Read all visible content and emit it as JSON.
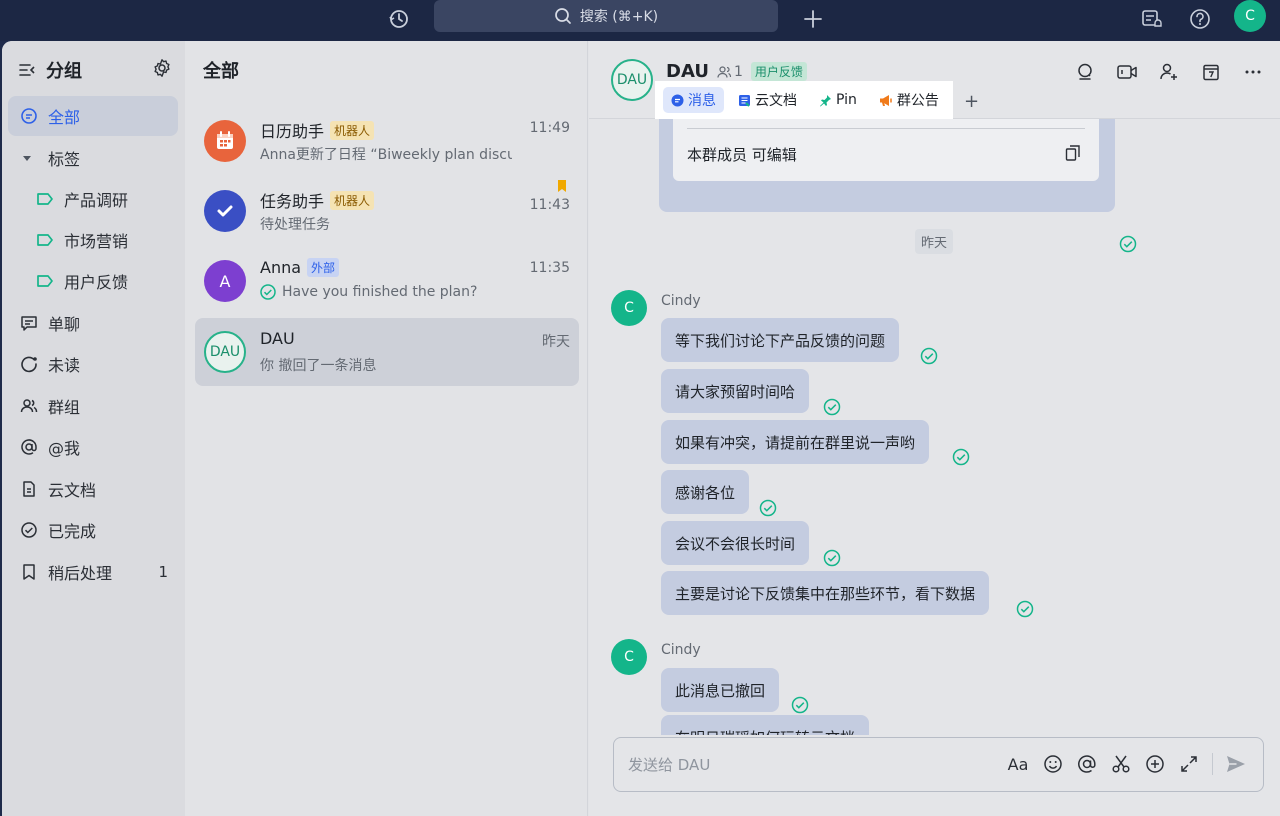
{
  "topbar": {
    "search_placeholder": "搜索 (⌘+K)",
    "avatar_initial": "C"
  },
  "sidebar": {
    "title": "分组",
    "items": [
      {
        "label": "全部",
        "icon": "chat-bubble-icon",
        "active": true
      },
      {
        "label": "标签",
        "icon": "caret-down-icon"
      },
      {
        "label": "产品调研",
        "icon": "tag-icon",
        "sub": true
      },
      {
        "label": "市场营销",
        "icon": "tag-icon",
        "sub": true
      },
      {
        "label": "用户反馈",
        "icon": "tag-icon",
        "sub": true
      },
      {
        "label": "单聊",
        "icon": "direct-chat-icon"
      },
      {
        "label": "未读",
        "icon": "unread-icon"
      },
      {
        "label": "群组",
        "icon": "group-icon"
      },
      {
        "label": "@我",
        "icon": "at-icon"
      },
      {
        "label": "云文档",
        "icon": "document-icon"
      },
      {
        "label": "已完成",
        "icon": "check-circle-icon"
      },
      {
        "label": "稍后处理",
        "icon": "bookmark-icon",
        "count": "1"
      }
    ]
  },
  "list": {
    "title": "全部",
    "chats": [
      {
        "name": "日历助手",
        "tag": "机器人",
        "preview": "Anna更新了日程 “Biweekly plan discu...",
        "time": "11:49"
      },
      {
        "name": "任务助手",
        "tag": "机器人",
        "preview": "待处理任务",
        "time": "11:43"
      },
      {
        "name": "Anna",
        "tag": "外部",
        "preview": "Have you finished the plan?",
        "time": "11:35",
        "avatar": "A"
      },
      {
        "name": "DAU",
        "preview": "你 撤回了一条消息",
        "time": "昨天",
        "avatar": "DAU"
      }
    ]
  },
  "conversation": {
    "avatar": "DAU",
    "name": "DAU",
    "member_count": "1",
    "tag": "用户反馈",
    "tabs": [
      "消息",
      "云文档",
      "Pin",
      "群公告"
    ],
    "tab_add": "+",
    "card_text": "本群成员 可编辑",
    "date_separator": "昨天",
    "groups": [
      {
        "sender": "Cindy",
        "avatar": "C",
        "messages": [
          "等下我们讨论下产品反馈的问题",
          "请大家预留时间哈",
          "如果有冲突，请提前在群里说一声哟",
          "感谢各位",
          "会议不会很长时间",
          "主要是讨论下反馈集中在那些环节，看下数据"
        ]
      },
      {
        "sender": "Cindy",
        "avatar": "C",
        "messages": [
          "此消息已撤回",
          "在明日瑞瑶如何玩转云文档"
        ]
      }
    ],
    "input_placeholder": "发送给 DAU",
    "format_label": "Aa"
  },
  "colors": {
    "accent": "#2d60e8",
    "green": "#14b58a",
    "bubble": "#c4cce0"
  }
}
